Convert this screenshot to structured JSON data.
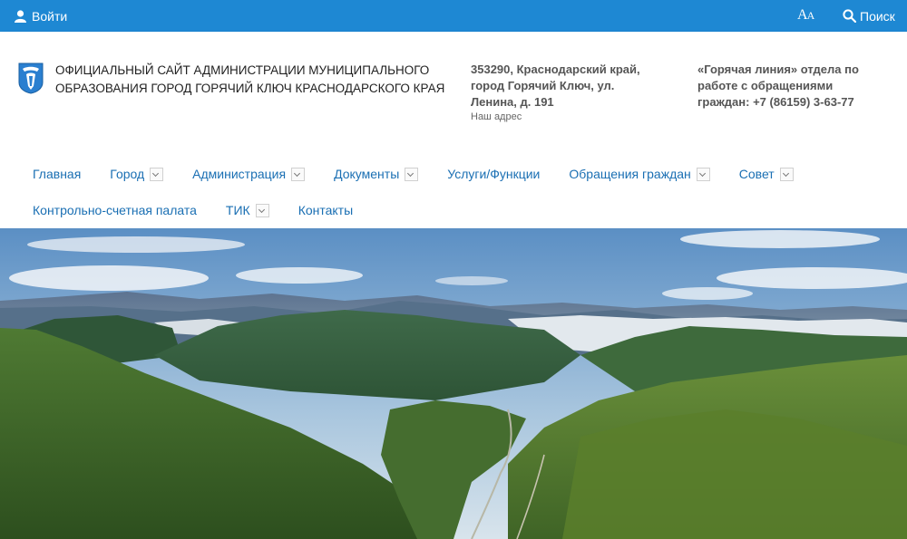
{
  "topbar": {
    "login_label": "Войти",
    "font_size_big": "A",
    "font_size_small": "A",
    "search_label": "Поиск",
    "background_color": "#1e88d3"
  },
  "header": {
    "title": "Официальный сайт администрации  муниципального образования город Горячий Ключ Краснодарского края",
    "address": "353290, Краснодарский край, город Горячий Ключ, ул. Ленина, д. 191",
    "address_caption": "Наш адрес",
    "hotline": "«Горячая линия» отдела по работе с обращениями граждан: +7 (86159) 3-63-77"
  },
  "nav": {
    "row1": [
      {
        "label": "Главная",
        "has_dropdown": false
      },
      {
        "label": "Город",
        "has_dropdown": true
      },
      {
        "label": "Администрация",
        "has_dropdown": true
      },
      {
        "label": "Документы",
        "has_dropdown": true
      },
      {
        "label": "Услуги/Функции",
        "has_dropdown": false
      },
      {
        "label": "Обращения граждан",
        "has_dropdown": true
      },
      {
        "label": "Совет",
        "has_dropdown": true
      }
    ],
    "row2": [
      {
        "label": "Контрольно-счетная палата",
        "has_dropdown": false
      },
      {
        "label": "ТИК",
        "has_dropdown": true
      },
      {
        "label": "Контакты",
        "has_dropdown": false
      }
    ],
    "link_color": "#1a6fb3"
  },
  "icons": {
    "login": "user-icon",
    "font_size": "font-size-icon",
    "search": "search-icon",
    "dropdown": "chevron-down-icon",
    "logo": "coat-of-arms-icon"
  }
}
